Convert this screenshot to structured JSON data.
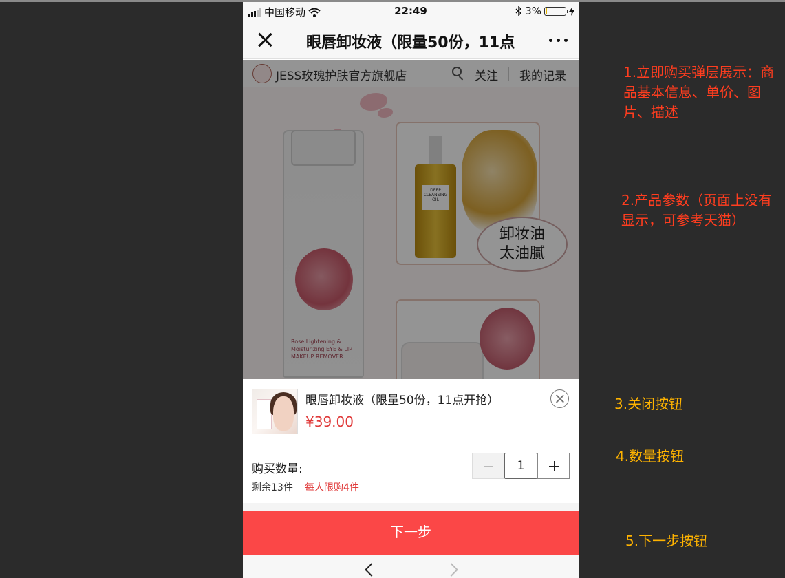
{
  "status_bar": {
    "carrier": "中国移动",
    "time": "22:49",
    "battery_percent": "3%",
    "icons": [
      "signal-icon",
      "wifi-icon",
      "bluetooth-icon",
      "battery-icon",
      "charging-icon"
    ]
  },
  "nav_bar": {
    "title": "眼唇卸妆液（限量50份，11点",
    "close_icon": "close-icon",
    "more_icon": "more-icon"
  },
  "shop_bar": {
    "name": "JESS玫瑰护肤官方旗舰店",
    "follow_label": "关注",
    "records_label": "我的记录"
  },
  "banner": {
    "oil_bubble_line1": "卸妆油",
    "oil_bubble_line2": "太油腻",
    "bottle_text": "Rose Lightening & Moisturizing EYE & LIP MAKEUP REMOVER",
    "oil_label": "DEEP CLEANSING OIL"
  },
  "purchase_modal": {
    "product_title": "眼唇卸妆液（限量50份，11点开抢）",
    "price": "¥39.00",
    "quantity_label": "购买数量:",
    "quantity_value": "1",
    "stock_text": "剩余13件",
    "limit_text": "每人限购4件",
    "next_button_label": "下一步"
  },
  "annotations": [
    {
      "text": "1.立即购买弹层展示：商品基本信息、单价、图片、描述",
      "color": "#ff3d1f"
    },
    {
      "text": "2.产品参数（页面上没有显示，可参考天猫）",
      "color": "#ff3d1f"
    },
    {
      "text": "3.关闭按钮",
      "color": "#ffb300"
    },
    {
      "text": "4.数量按钮",
      "color": "#ffb300"
    },
    {
      "text": "5.下一步按钮",
      "color": "#ffb300"
    }
  ],
  "colors": {
    "accent_red": "#fb4747",
    "price_red": "#e03a3a",
    "note_red": "#ff3d1f",
    "note_yellow": "#ffb300",
    "background": "#2b2b2b"
  }
}
